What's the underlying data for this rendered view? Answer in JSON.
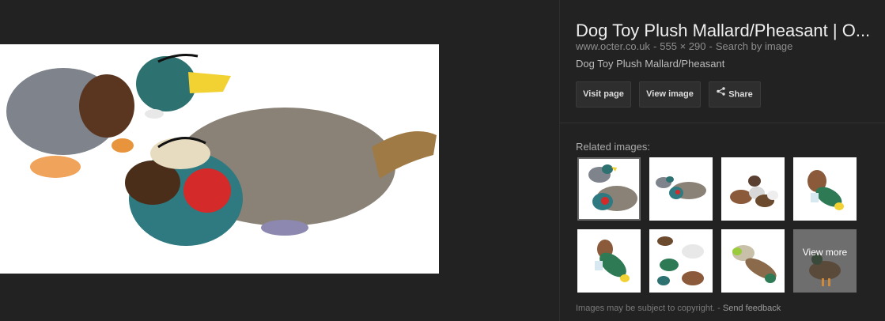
{
  "result": {
    "title": "Dog Toy Plush Mallard/Pheasant | O...",
    "domain": "www.octer.co.uk",
    "separator": "-",
    "dimensions": "555 × 290",
    "search_by_image": "Search by image",
    "description": "Dog Toy Plush Mallard/Pheasant"
  },
  "buttons": {
    "visit_page": "Visit page",
    "view_image": "View image",
    "share": "Share"
  },
  "related": {
    "heading": "Related images:",
    "view_more": "View more"
  },
  "footer": {
    "copyright": "Images may be subject to copyright.",
    "separator": "-",
    "send_feedback": "Send feedback"
  },
  "colors": {
    "background": "#222222",
    "title": "#eeeeee",
    "meta": "#8d8d8d",
    "button_bg": "#2e2e2e"
  }
}
